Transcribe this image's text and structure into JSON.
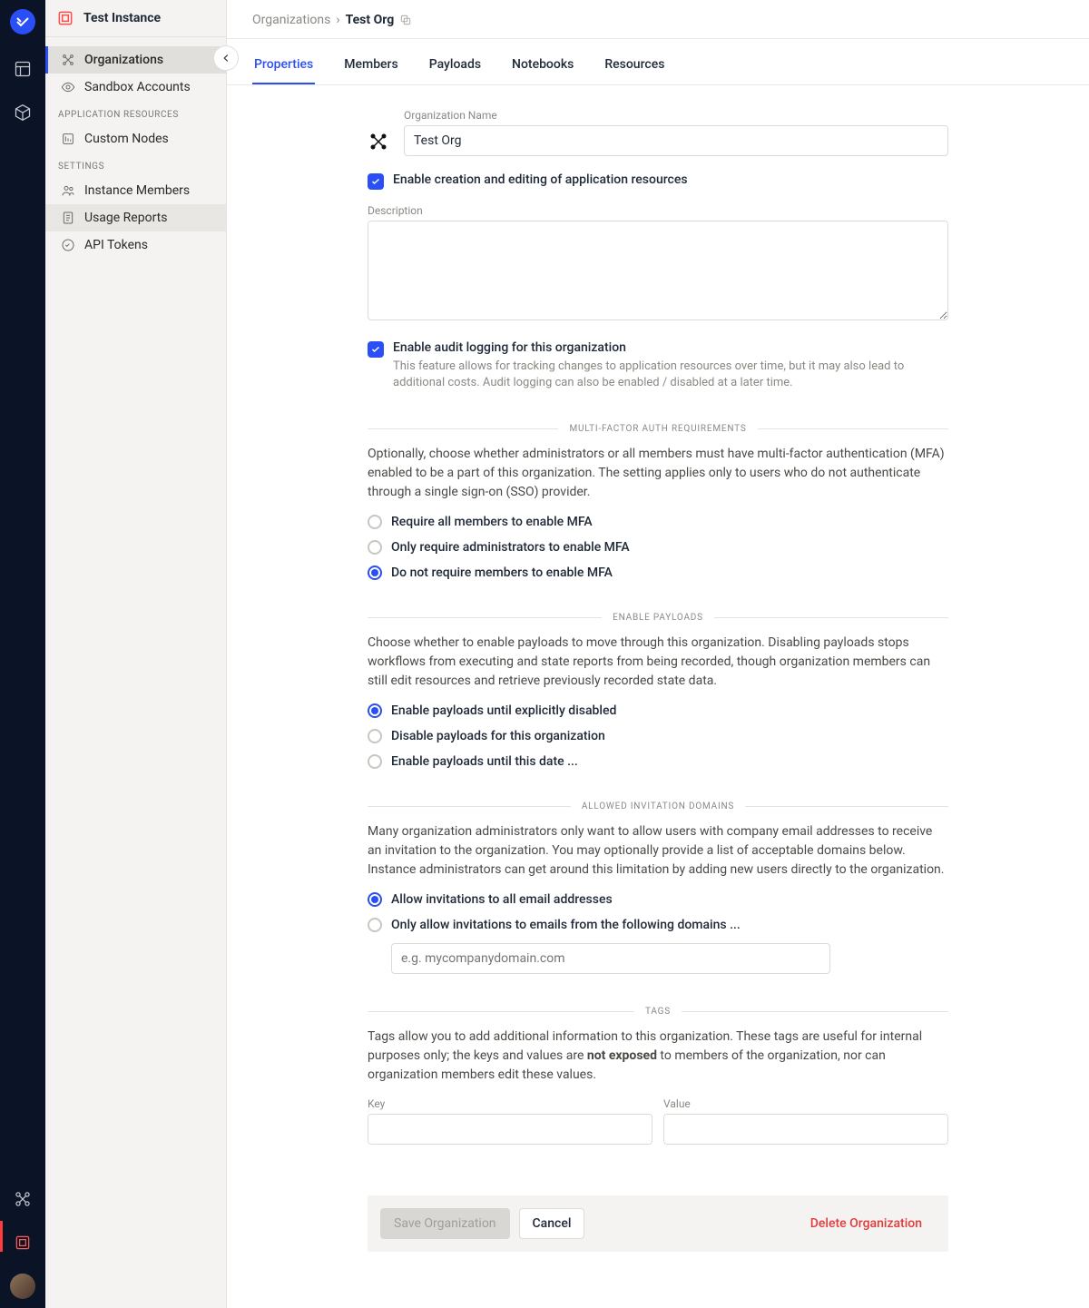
{
  "instance_name": "Test Instance",
  "breadcrumb": {
    "root": "Organizations",
    "current": "Test Org"
  },
  "sidebar": {
    "primary": [
      {
        "id": "organizations",
        "label": "Organizations",
        "icon": "network-icon",
        "active": true
      },
      {
        "id": "sandbox",
        "label": "Sandbox Accounts",
        "icon": "eye-icon"
      }
    ],
    "app_resources_title": "APPLICATION RESOURCES",
    "app_resources": [
      {
        "id": "custom-nodes",
        "label": "Custom Nodes",
        "icon": "node-icon"
      }
    ],
    "settings_title": "SETTINGS",
    "settings": [
      {
        "id": "instance-members",
        "label": "Instance Members",
        "icon": "members-icon"
      },
      {
        "id": "usage-reports",
        "label": "Usage Reports",
        "icon": "report-icon",
        "highlight": true
      },
      {
        "id": "api-tokens",
        "label": "API Tokens",
        "icon": "token-icon"
      }
    ]
  },
  "tabs": [
    "Properties",
    "Members",
    "Payloads",
    "Notebooks",
    "Resources"
  ],
  "active_tab": "Properties",
  "form": {
    "org_name_label": "Organization Name",
    "org_name_value": "Test Org",
    "enable_creation_label": "Enable creation and editing of application resources",
    "enable_creation_checked": true,
    "description_label": "Description",
    "description_value": "",
    "audit_label": "Enable audit logging for this organization",
    "audit_checked": true,
    "audit_help": "This feature allows for tracking changes to application resources over time, but it may also lead to additional costs. Audit logging can also be enabled / disabled at a later time.",
    "mfa": {
      "title": "MULTI-FACTOR AUTH REQUIREMENTS",
      "desc": "Optionally, choose whether administrators or all members must have multi-factor authentication (MFA) enabled to be a part of this organization. The setting applies only to users who do not authenticate through a single sign-on (SSO) provider.",
      "options": [
        "Require all members to enable MFA",
        "Only require administrators to enable MFA",
        "Do not require members to enable MFA"
      ],
      "selected": 2
    },
    "payloads": {
      "title": "ENABLE PAYLOADS",
      "desc": "Choose whether to enable payloads to move through this organization. Disabling payloads stops workflows from executing and state reports from being recorded, though organization members can still edit resources and retrieve previously recorded state data.",
      "options": [
        "Enable payloads until explicitly disabled",
        "Disable payloads for this organization",
        "Enable payloads until this date ..."
      ],
      "selected": 0
    },
    "domains": {
      "title": "ALLOWED INVITATION DOMAINS",
      "desc": "Many organization administrators only want to allow users with company email addresses to receive an invitation to the organization. You may optionally provide a list of acceptable domains below. Instance administrators can get around this limitation by adding new users directly to the organization.",
      "options": [
        "Allow invitations to all email addresses",
        "Only allow invitations to emails from the following domains ..."
      ],
      "selected": 0,
      "placeholder": "e.g. mycompanydomain.com"
    },
    "tags": {
      "title": "TAGS",
      "desc_pre": "Tags allow you to add additional information to this organization. These tags are useful for internal purposes only; the keys and values are ",
      "desc_bold": "not exposed",
      "desc_post": " to members of the organization, nor can organization members edit these values.",
      "key_label": "Key",
      "value_label": "Value"
    }
  },
  "footer": {
    "save": "Save Organization",
    "cancel": "Cancel",
    "delete": "Delete Organization"
  }
}
